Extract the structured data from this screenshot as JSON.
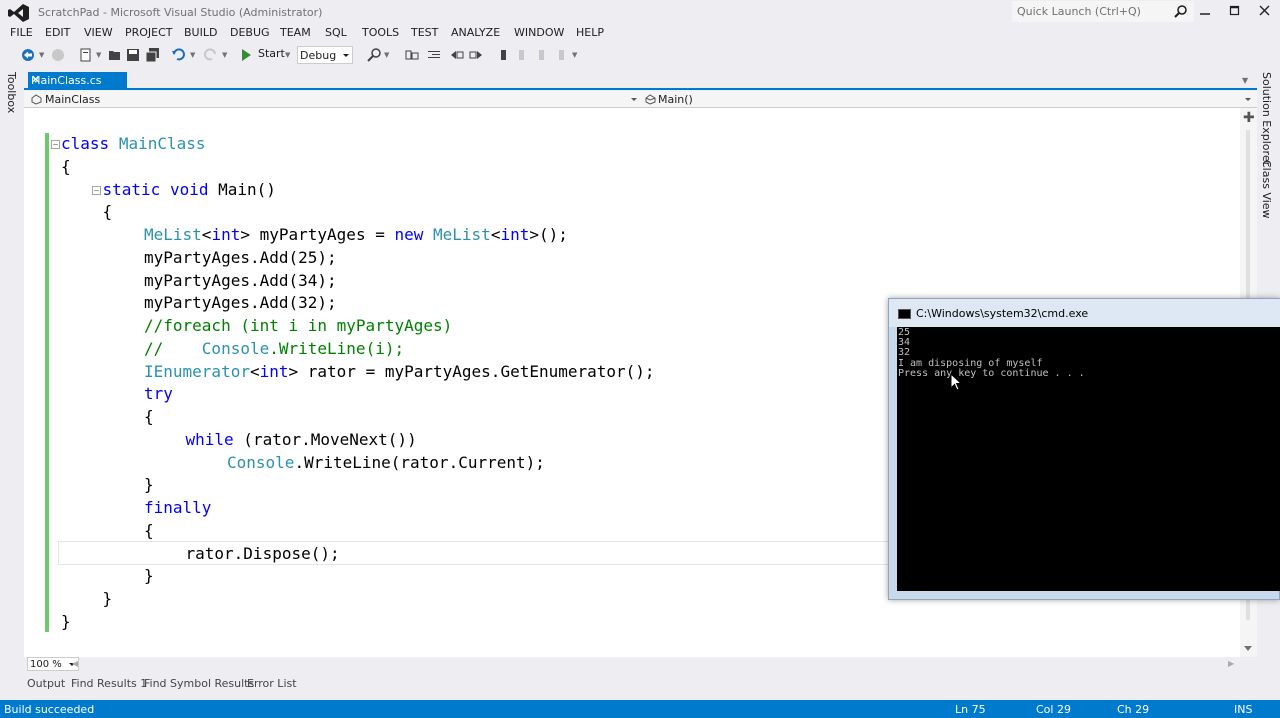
{
  "window": {
    "title": "ScratchPad - Microsoft Visual Studio (Administrator)",
    "quick_launch_placeholder": "Quick Launch (Ctrl+Q)"
  },
  "menu": [
    "FILE",
    "EDIT",
    "VIEW",
    "PROJECT",
    "BUILD",
    "DEBUG",
    "TEAM",
    "SQL",
    "TOOLS",
    "TEST",
    "ANALYZE",
    "WINDOW",
    "HELP"
  ],
  "toolbar": {
    "start_label": "Start",
    "config_value": "Debug"
  },
  "side_panels": {
    "left": "Toolbox",
    "right": [
      "Solution Explorer",
      "Class View"
    ]
  },
  "tabs": {
    "active": "MainClass.cs",
    "close_glyph": "✕"
  },
  "navbar": {
    "type_value": "MainClass",
    "member_value": "Main()"
  },
  "code": {
    "lines": [
      {
        "indent": 0,
        "tokens": [
          [
            "kw",
            "class"
          ],
          [
            "t",
            " "
          ],
          [
            "ty",
            "MainClass"
          ]
        ]
      },
      {
        "indent": 0,
        "tokens": [
          [
            "t",
            "{"
          ]
        ]
      },
      {
        "indent": 1,
        "tokens": [
          [
            "kw",
            "static"
          ],
          [
            "t",
            " "
          ],
          [
            "kw",
            "void"
          ],
          [
            "t",
            " Main()"
          ]
        ]
      },
      {
        "indent": 1,
        "tokens": [
          [
            "t",
            "{"
          ]
        ]
      },
      {
        "indent": 2,
        "tokens": [
          [
            "ty",
            "MeList"
          ],
          [
            "t",
            "<"
          ],
          [
            "kw",
            "int"
          ],
          [
            "t",
            "> myPartyAges = "
          ],
          [
            "kw",
            "new"
          ],
          [
            "t",
            " "
          ],
          [
            "ty",
            "MeList"
          ],
          [
            "t",
            "<"
          ],
          [
            "kw",
            "int"
          ],
          [
            "t",
            ">();"
          ]
        ]
      },
      {
        "indent": 2,
        "tokens": [
          [
            "t",
            "myPartyAges.Add(25);"
          ]
        ]
      },
      {
        "indent": 2,
        "tokens": [
          [
            "t",
            "myPartyAges.Add(34);"
          ]
        ]
      },
      {
        "indent": 2,
        "tokens": [
          [
            "t",
            "myPartyAges.Add(32);"
          ]
        ]
      },
      {
        "indent": 2,
        "tokens": [
          [
            "cm",
            "//foreach (int i in myPartyAges)"
          ]
        ]
      },
      {
        "indent": 2,
        "tokens": [
          [
            "cm",
            "//    "
          ],
          [
            "ty",
            "Console"
          ],
          [
            "cm",
            ".WriteLine(i);"
          ]
        ]
      },
      {
        "indent": 2,
        "tokens": [
          [
            "ty",
            "IEnumerator"
          ],
          [
            "t",
            "<"
          ],
          [
            "kw",
            "int"
          ],
          [
            "t",
            "> rator = myPartyAges.GetEnumerator();"
          ]
        ]
      },
      {
        "indent": 2,
        "tokens": [
          [
            "kw",
            "try"
          ]
        ]
      },
      {
        "indent": 2,
        "tokens": [
          [
            "t",
            "{"
          ]
        ]
      },
      {
        "indent": 3,
        "tokens": [
          [
            "kw",
            "while"
          ],
          [
            "t",
            " (rator.MoveNext())"
          ]
        ]
      },
      {
        "indent": 4,
        "tokens": [
          [
            "ty",
            "Console"
          ],
          [
            "t",
            ".WriteLine(rator.Current);"
          ]
        ]
      },
      {
        "indent": 2,
        "tokens": [
          [
            "t",
            "}"
          ]
        ]
      },
      {
        "indent": 2,
        "tokens": [
          [
            "kw",
            "finally"
          ]
        ]
      },
      {
        "indent": 2,
        "tokens": [
          [
            "t",
            "{"
          ]
        ]
      },
      {
        "indent": 3,
        "tokens": [
          [
            "t",
            "rator.Dispose();"
          ]
        ]
      },
      {
        "indent": 2,
        "tokens": [
          [
            "t",
            "}"
          ]
        ]
      },
      {
        "indent": 1,
        "tokens": [
          [
            "t",
            "}"
          ]
        ]
      },
      {
        "indent": 0,
        "tokens": [
          [
            "t",
            "}"
          ]
        ]
      }
    ]
  },
  "zoom": "100 %",
  "bottom_tabs": [
    "Output",
    "Find Results 1",
    "Find Symbol Results",
    "Error List"
  ],
  "status": {
    "message": "Build succeeded",
    "ln": "Ln 75",
    "col": "Col 29",
    "ch": "Ch 29",
    "mode": "INS"
  },
  "console": {
    "title": "C:\\Windows\\system32\\cmd.exe",
    "lines": [
      "25",
      "34",
      "32",
      "I am disposing of myself",
      "Press any key to continue . . ."
    ]
  },
  "colors": {
    "accent": "#007acc",
    "keyword": "#0000ff",
    "type": "#2b91af",
    "comment": "#008000",
    "change_bar": "#6bcb6b"
  }
}
